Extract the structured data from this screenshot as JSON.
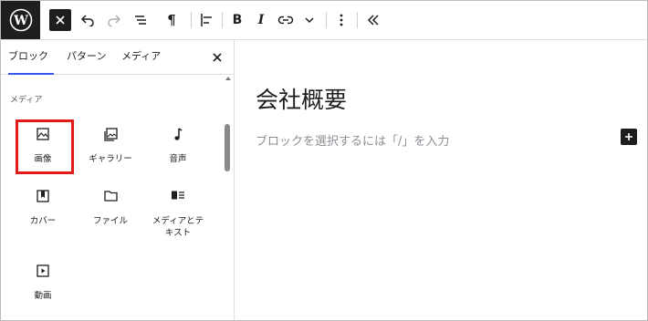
{
  "toolbar": {
    "bold_label": "B",
    "italic_label": "I",
    "paragraph_label": "¶"
  },
  "sidebar": {
    "tabs": [
      {
        "label": "ブロック",
        "active": true
      },
      {
        "label": "パターン",
        "active": false
      },
      {
        "label": "メディア",
        "active": false
      }
    ],
    "section_title": "メディア",
    "blocks": [
      {
        "label": "画像",
        "icon": "image-icon",
        "highlighted": true
      },
      {
        "label": "ギャラリー",
        "icon": "gallery-icon"
      },
      {
        "label": "音声",
        "icon": "audio-icon"
      },
      {
        "label": "カバー",
        "icon": "cover-icon"
      },
      {
        "label": "ファイル",
        "icon": "file-icon"
      },
      {
        "label": "メディアとテキスト",
        "icon": "media-text-icon"
      },
      {
        "label": "動画",
        "icon": "video-icon"
      }
    ]
  },
  "editor": {
    "title": "会社概要",
    "placeholder": "ブロックを選択するには「/」を入力"
  },
  "colors": {
    "dark": "#1e1e1e",
    "highlight": "#e21a1a",
    "tab_accent": "#3858e9",
    "placeholder": "#8c8f94"
  }
}
